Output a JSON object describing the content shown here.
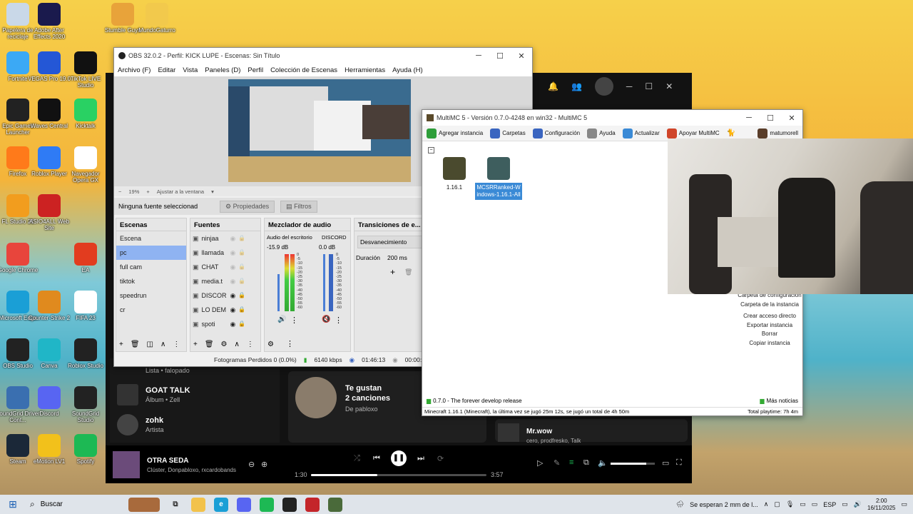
{
  "desktop": {
    "icons": [
      {
        "label": "Papelera de reciclaje",
        "icon": "recycle-bin-icon",
        "color": "#c9d8e8"
      },
      {
        "label": "Adobe After Effects 2020",
        "icon": "after-effects-icon",
        "color": "#1a1a4d"
      },
      {
        "label": "Stumble Guys",
        "icon": "stumble-guys-icon",
        "color": "#e8a33a"
      },
      {
        "label": "MundoGaturro",
        "icon": "mundogaturro-icon",
        "color": "#f2c94c"
      },
      {
        "label": "Fortnite",
        "icon": "fortnite-icon",
        "color": "#3ba9f5"
      },
      {
        "label": "VEGAS Pro 19.0",
        "icon": "vegas-icon",
        "color": "#2457d6"
      },
      {
        "label": "TikTok LIVE Studio",
        "icon": "tiktok-icon",
        "color": "#111111"
      },
      {
        "label": "Epic Games Launcher",
        "icon": "epic-games-icon",
        "color": "#222222"
      },
      {
        "label": "Waves Central",
        "icon": "waves-icon",
        "color": "#111111"
      },
      {
        "label": "Kicktalk",
        "icon": "kick-icon",
        "color": "#29d163"
      },
      {
        "label": "Firefox",
        "icon": "firefox-icon",
        "color": "#ff7a1a"
      },
      {
        "label": "Roblox Player",
        "icon": "roblox-icon",
        "color": "#2f7bf5"
      },
      {
        "label": "Navegador Opera GX",
        "icon": "opera-icon",
        "color": "#ffffff"
      },
      {
        "label": "FL Studio 21",
        "icon": "fl-studio-icon",
        "color": "#f29d1e"
      },
      {
        "label": "ASIO4ALL Web Site",
        "icon": "asio-icon",
        "color": "#cc2222"
      },
      {
        "label": "Google Chrome",
        "icon": "chrome-icon",
        "color": "#e8453c"
      },
      {
        "label": "EA",
        "icon": "ea-icon",
        "color": "#e23c1f"
      },
      {
        "label": "Microsoft Edge",
        "icon": "edge-icon",
        "color": "#1a9fd6"
      },
      {
        "label": "Counter-Strike 2",
        "icon": "cs2-icon",
        "color": "#e08a1e"
      },
      {
        "label": "FIFA 23",
        "icon": "file-icon",
        "color": "#ffffff"
      },
      {
        "label": "OBS Studio",
        "icon": "obs-icon",
        "color": "#222222"
      },
      {
        "label": "Canva",
        "icon": "canva-icon",
        "color": "#20b6c7"
      },
      {
        "label": "Roblox Studio",
        "icon": "roblox-studio-icon",
        "color": "#222222"
      },
      {
        "label": "SoundGrid Driver Cont...",
        "icon": "soundgrid-driver-icon",
        "color": "#3a6fb0"
      },
      {
        "label": "Discord",
        "icon": "discord-icon",
        "color": "#5865f2"
      },
      {
        "label": "SoundGrid Studio",
        "icon": "soundgrid-studio-icon",
        "color": "#222222"
      },
      {
        "label": "Steam",
        "icon": "steam-icon",
        "color": "#1b2838"
      },
      {
        "label": "eMotion LV1",
        "icon": "emotion-icon",
        "color": "#f2c11b"
      },
      {
        "label": "Spotify",
        "icon": "spotify-icon",
        "color": "#1db954"
      }
    ]
  },
  "obs": {
    "title": "OBS 32.0.2 - Perfil: KICK LUPE - Escenas: Sin Título",
    "menu": [
      "Archivo (F)",
      "Editar",
      "Vista",
      "Paneles (D)",
      "Perfil",
      "Colección de Escenas",
      "Herramientas",
      "Ayuda (H)"
    ],
    "zoom": "19%",
    "zoom_fit": "Ajustar a la ventana",
    "no_source": "Ninguna fuente seleccionad",
    "properties_btn": "Propiedades",
    "filters_btn": "Filtros",
    "scenes_title": "Escenas",
    "scenes": [
      "Escena",
      "pc",
      "full cam",
      "tiktok",
      "speedrun",
      "cr"
    ],
    "selected_scene": 1,
    "sources_title": "Fuentes",
    "sources": [
      "ninjaa",
      "llamada",
      "CHAT",
      "media.t",
      "DISCOR",
      "LO DEM",
      "spoti"
    ],
    "mixer_title": "Mezclador de audio",
    "mixer": [
      {
        "name": "Audio del escritorio",
        "db": "-15.9 dB"
      },
      {
        "name": "DISCORD",
        "db": "0.0 dB"
      }
    ],
    "meter_scale": [
      "0",
      "-5",
      "-10",
      "-15",
      "-20",
      "-25",
      "-30",
      "-35",
      "-40",
      "-45",
      "-50",
      "-55",
      "-60"
    ],
    "transitions_title": "Transiciones de e...",
    "transition": "Desvanecimiento",
    "duration_label": "Duración",
    "duration": "200 ms",
    "status_frames": "Fotogramas Perdidos 0 (0.0%)",
    "status_kbps": "6140 kbps",
    "status_time": "01:46:13",
    "status_time2": "00:00:0"
  },
  "spotify": {
    "rows": [
      {
        "title": "GOAT TALK",
        "sub": "Álbum • Zell"
      },
      {
        "title": "zohk",
        "sub": "Artista"
      }
    ],
    "partial_row": "Lista • falopado",
    "liked_title": "Te gustan",
    "liked_count": "2 canciones",
    "liked_by": "De pabloxo",
    "right_title": "Mr.wow",
    "right_sub": "cero, prodfresko, Talk",
    "now_playing_title": "OTRA SEDA",
    "now_playing_artists": "Clúster, Donpabloxo, rxcardobands",
    "elapsed": "1:30",
    "total": "3:57",
    "progress": 0.38,
    "volume": 0.8
  },
  "multimc": {
    "title": "MultiMC 5 - Versión 0.7.0-4248 en win32 - MultiMC 5",
    "toolbar": [
      "Agregar instancia",
      "Carpetas",
      "Configuración",
      "Ayuda",
      "Actualizar",
      "Apoyar MultiMC"
    ],
    "user": "matumorell",
    "instances": [
      {
        "name": "1.16.1",
        "selected": false
      },
      {
        "name": "MCSRRanked-Windows-1.16.1-All",
        "selected": true
      }
    ],
    "side_actions": [
      "Carpeta de configuración",
      "Carpeta de la instancia",
      "Crear acceso directo",
      "Exportar instancia",
      "Borrar",
      "Copiar instancia"
    ],
    "news": "0.7.0 - The forever develop release",
    "more_news": "Más noticias",
    "status": "Minecraft 1.16.1 (Minecraft), la última vez se jugó 25m 12s, se jugó un total de 4h 50m",
    "playtime": "Total playtime: 7h 4m"
  },
  "taskbar": {
    "search_placeholder": "Buscar",
    "weather": "Se esperan 2 mm de l...",
    "lang": "ESP",
    "time": "2:00",
    "date": "16/11/2025"
  }
}
